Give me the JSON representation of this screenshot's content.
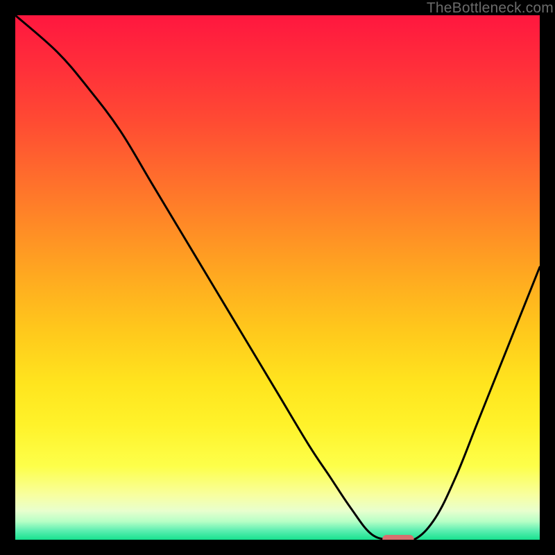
{
  "watermark": "TheBottleneck.com",
  "colors": {
    "black": "#000000",
    "curve": "#000000",
    "marker": "#d6706f",
    "gradient_stops": [
      {
        "offset": 0.0,
        "color": "#ff173f"
      },
      {
        "offset": 0.1,
        "color": "#ff2f3a"
      },
      {
        "offset": 0.2,
        "color": "#ff4a33"
      },
      {
        "offset": 0.3,
        "color": "#ff6a2d"
      },
      {
        "offset": 0.4,
        "color": "#ff8a26"
      },
      {
        "offset": 0.5,
        "color": "#ffaa20"
      },
      {
        "offset": 0.6,
        "color": "#ffc81c"
      },
      {
        "offset": 0.7,
        "color": "#ffe41e"
      },
      {
        "offset": 0.78,
        "color": "#fff22a"
      },
      {
        "offset": 0.86,
        "color": "#fdff4a"
      },
      {
        "offset": 0.915,
        "color": "#f8ffa0"
      },
      {
        "offset": 0.945,
        "color": "#e8ffce"
      },
      {
        "offset": 0.965,
        "color": "#b7ffc6"
      },
      {
        "offset": 0.982,
        "color": "#5fefb2"
      },
      {
        "offset": 1.0,
        "color": "#17e28f"
      }
    ]
  },
  "chart_data": {
    "type": "line",
    "title": "",
    "xlabel": "",
    "ylabel": "",
    "xlim": [
      0,
      100
    ],
    "ylim": [
      0,
      100
    ],
    "series": [
      {
        "name": "bottleneck-curve",
        "x": [
          0,
          8,
          14,
          20,
          26,
          32,
          38,
          44,
          50,
          56,
          60,
          64,
          68,
          72,
          76,
          80,
          84,
          88,
          92,
          96,
          100
        ],
        "y": [
          100,
          93,
          86,
          78,
          68,
          58,
          48,
          38,
          28,
          18,
          12,
          6,
          1,
          0,
          0,
          4,
          12,
          22,
          32,
          42,
          52
        ]
      }
    ],
    "marker": {
      "x_range": [
        70,
        76
      ],
      "y": 0
    },
    "annotations": []
  }
}
